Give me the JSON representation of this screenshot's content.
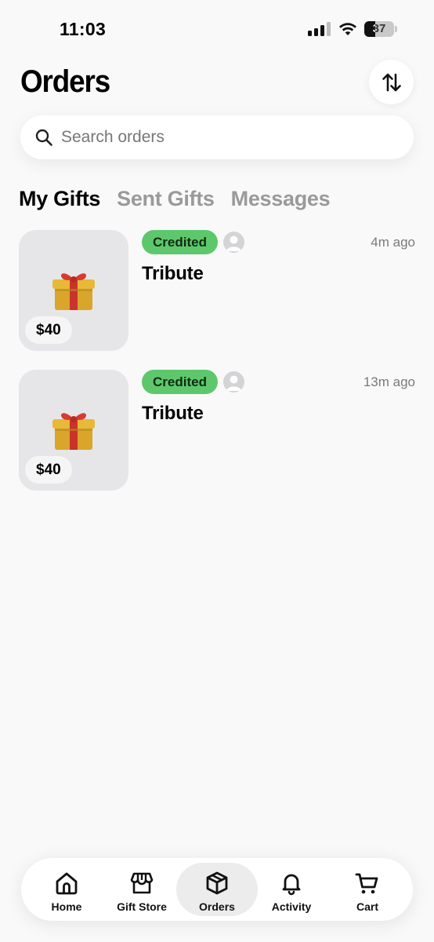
{
  "status_bar": {
    "time": "11:03",
    "battery_percent": "37",
    "battery_level": 0.37,
    "signal_bars_active": 3
  },
  "header": {
    "title": "Orders",
    "sort_icon": "sort-arrows-icon"
  },
  "search": {
    "placeholder": "Search orders",
    "value": "",
    "icon": "search-icon"
  },
  "tabs": [
    {
      "label": "My Gifts",
      "active": true
    },
    {
      "label": "Sent Gifts",
      "active": false
    },
    {
      "label": "Messages",
      "active": false
    }
  ],
  "orders": [
    {
      "status": "Credited",
      "title": "Tribute",
      "price": "$40",
      "time": "4m ago",
      "icon": "gift-box-icon"
    },
    {
      "status": "Credited",
      "title": "Tribute",
      "price": "$40",
      "time": "13m ago",
      "icon": "gift-box-icon"
    }
  ],
  "bottom_nav": [
    {
      "label": "Home",
      "icon": "home-icon",
      "active": false
    },
    {
      "label": "Gift Store",
      "icon": "store-icon",
      "active": false
    },
    {
      "label": "Orders",
      "icon": "package-icon",
      "active": true
    },
    {
      "label": "Activity",
      "icon": "bell-icon",
      "active": false
    },
    {
      "label": "Cart",
      "icon": "cart-icon",
      "active": false
    }
  ],
  "colors": {
    "background": "#f9f9f9",
    "credited_badge": "#5dc86b",
    "inactive_tab": "#9a9a9a",
    "thumb_bg": "#e6e6e9"
  }
}
